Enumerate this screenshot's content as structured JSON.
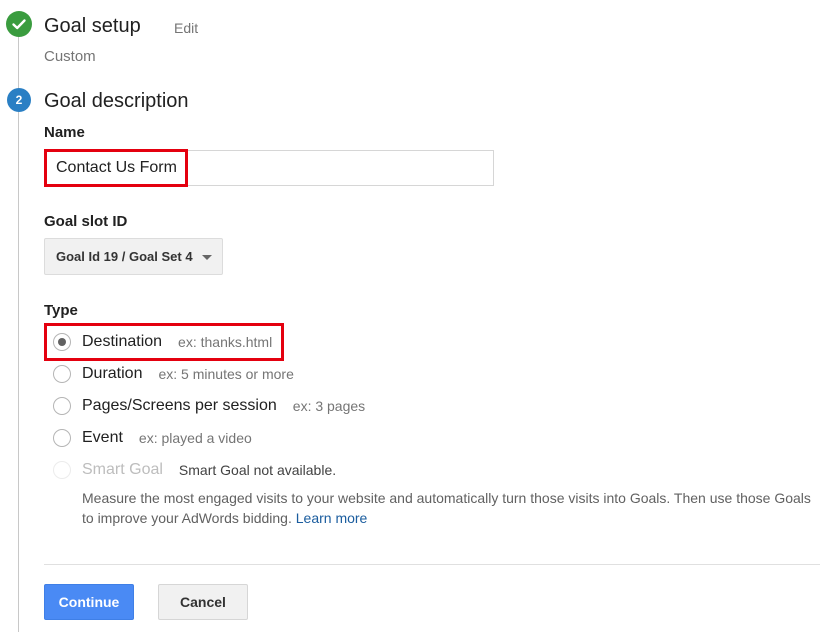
{
  "steps": [
    {
      "status": "complete",
      "icon": "check-icon",
      "title": "Goal setup",
      "edit_label": "Edit",
      "summary": "Custom"
    },
    {
      "status": "active",
      "number": "2",
      "title": "Goal description"
    }
  ],
  "form": {
    "name": {
      "label": "Name",
      "value": "Contact Us Form"
    },
    "goal_slot": {
      "label": "Goal slot ID",
      "selected": "Goal Id 19 / Goal Set 4"
    },
    "type": {
      "label": "Type",
      "options": [
        {
          "label": "Destination",
          "example": "ex: thanks.html",
          "checked": true,
          "disabled": false
        },
        {
          "label": "Duration",
          "example": "ex: 5 minutes or more",
          "checked": false,
          "disabled": false
        },
        {
          "label": "Pages/Screens per session",
          "example": "ex: 3 pages",
          "checked": false,
          "disabled": false
        },
        {
          "label": "Event",
          "example": "ex: played a video",
          "checked": false,
          "disabled": false
        },
        {
          "label": "Smart Goal",
          "example": "Smart Goal not available.",
          "checked": false,
          "disabled": true
        }
      ],
      "smart_goal_description": "Measure the most engaged visits to your website and automatically turn those visits into Goals. Then use those Goals to improve your AdWords bidding.",
      "learn_more_label": "Learn more"
    }
  },
  "actions": {
    "continue_label": "Continue",
    "cancel_label": "Cancel"
  },
  "colors": {
    "complete_green": "#3a9c3f",
    "active_blue": "#2a7fc4",
    "primary_button": "#4a8af4",
    "highlight_red": "#e4000f",
    "link_blue": "#1a5c9e"
  }
}
